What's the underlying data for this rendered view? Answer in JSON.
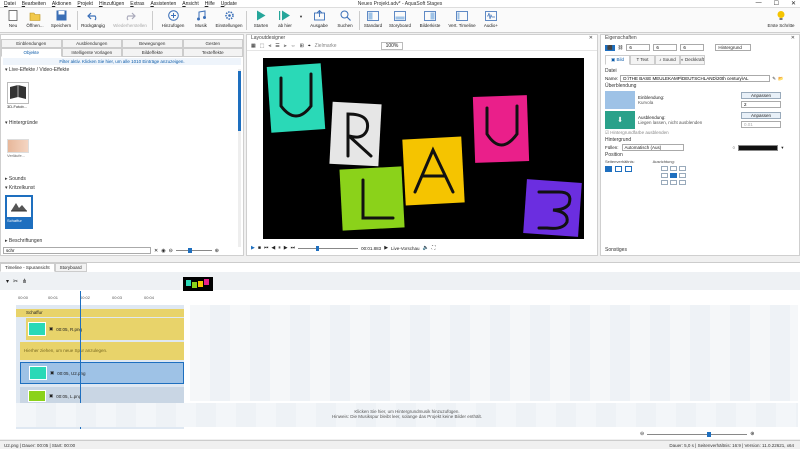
{
  "app": {
    "title": "Neues Projekt.adv* - AquaSoft Stages"
  },
  "menu": [
    "Datei",
    "Bearbeiten",
    "Aktionen",
    "Projekt",
    "Hinzufügen",
    "Extras",
    "Assistenten",
    "Ansicht",
    "Hilfe",
    "Update"
  ],
  "ribbon": {
    "neu": "Neu",
    "oeffnen": "Öffnen...",
    "speichern": "Speichern",
    "rueckgaengig": "Rückgängig",
    "wiederherstellen": "Wiederherstellen",
    "hinzufuegen": "Hinzufügen",
    "musik": "Musik",
    "einstellungen": "Einstellungen",
    "starten": "Starten",
    "ab_hier": "ab hier",
    "ausgabe": "Ausgabe",
    "suchen": "Suchen",
    "standard": "Standard",
    "storyboard": "Storyboard",
    "bilderkiste": "Bilderkiste",
    "vert_timeline": "Vert. Timeline",
    "audio_plus": "Audio+",
    "erste_schritte": "Erste Schritte"
  },
  "left": {
    "tabs_row1": [
      "Einblendungen",
      "Ausblendungen",
      "Bewegungen",
      "Gesten"
    ],
    "tabs_row2": [
      "Objekte",
      "Intelligente Vorlagen",
      "Bildeffekte",
      "Texteffekte"
    ],
    "filter_text": "Filter aktiv. Klicken Sie hier, um alle 1010 Einträge anzuzeigen.",
    "section_live": "Live-Effekte / Video-Effekte",
    "item_3d": "3D-Fotob...",
    "section_hintergruende": "Hintergründe",
    "item_verlaeufe": "Verläufe...",
    "section_sounds": "Sounds",
    "section_kritzelkunst": "Kritzelkunst",
    "item_schaffur": "Schaffur",
    "section_beschriftungen": "Beschriftungen",
    "search_value": "schr"
  },
  "mid": {
    "header": "Layoutdesigner",
    "zielmarke": "Zielmarke",
    "zoom": "100%",
    "time": "00:01.883",
    "live_vorschau": "Live-Vorschau",
    "letters": [
      "U",
      "R",
      "L",
      "A",
      "A",
      "U",
      "B"
    ]
  },
  "right": {
    "header": "Eigenschaften",
    "num1": "6",
    "num2": "6",
    "num3": "6",
    "hintergrund": "Hintergrund",
    "tabs": [
      "Bild",
      "Text",
      "Sound",
      "Deckkraft"
    ],
    "datei_label": "Datei",
    "name_label": "Name:",
    "name_value": "D:\\THE BASE MEULEKAMP\\DEUTSCHLAND\\20th century\\AL",
    "ueberblendung": "Überblendung",
    "einblendung": "Einblendung:",
    "einblendung_val": "Kurvola",
    "anpassen": "Anpassen",
    "ueb_num": "2",
    "ausblendung": "Ausblendung:",
    "ausblendung_val": "Liegen lassen, nicht ausblenden",
    "ausb_num": "0.01",
    "checkbox_label": "Hintergrundfarbe ausblenden",
    "hintergrund_section": "Hintergrund",
    "fuellen": "Füllen:",
    "fuellen_val": "Automatisch (Aus)",
    "position": "Position",
    "seitenverhaeltnis": "Seitenverhältnis:",
    "ausrichtung": "Ausrichtung:",
    "sonstiges": "Sonstiges"
  },
  "timeline": {
    "tab1": "Timeline - Spuransicht",
    "tab2": "Storyboard",
    "ticks": [
      "00:00",
      "00:01",
      "00:02",
      "00:03",
      "00:04"
    ],
    "group_label": "Schaffur",
    "track1": "00:05, R.png",
    "drop_hint": "Hierher ziehen, um neue Spur anzulegen.",
    "track2": "00:05, U2.png",
    "track3": "00:05, L.png",
    "music_hint1": "Klicken Sie hier, um Hintergrundmusik hinzuzufügen.",
    "music_hint2": "Hinweis: Die Musikspur bleibt leer, solange das Projekt keine Bilder enthält."
  },
  "status": {
    "left": "U2.png | Dauer: 00:05 | Start: 00:00",
    "right": "Dauer: 5,0 s | Seitenverhältnis: 16:9 | Version: 11.0.22621, x64"
  },
  "colors": {
    "accent": "#1e6fbf",
    "teal": "#2ad9b7",
    "yellow": "#f5c400",
    "magenta": "#ea1f8a",
    "purple": "#6b2ee0",
    "green": "#8bd21a",
    "white": "#e6e6e6",
    "track": "#e8d36a",
    "trackblue": "#9ec2e6"
  }
}
